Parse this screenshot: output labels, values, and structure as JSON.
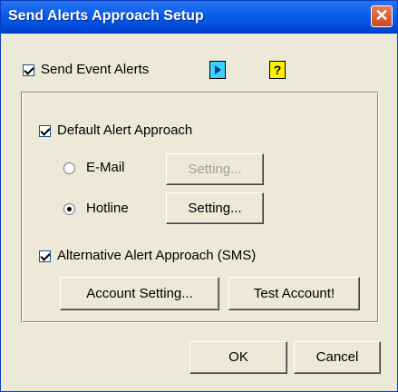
{
  "window": {
    "title": "Send Alerts Approach Setup",
    "close_symbol": "✕"
  },
  "send_event_alerts": {
    "label": "Send Event Alerts",
    "checked": true
  },
  "icons": {
    "play": "play-icon",
    "help": "help-icon",
    "help_glyph": "?"
  },
  "default_alert": {
    "label": "Default Alert Approach",
    "checked": true,
    "options": [
      {
        "label": "E-Mail",
        "selected": false,
        "setting_label": "Setting...",
        "setting_enabled": false
      },
      {
        "label": "Hotline",
        "selected": true,
        "setting_label": "Setting...",
        "setting_enabled": true
      }
    ]
  },
  "alternative_alert": {
    "label": "Alternative Alert Approach (SMS)",
    "checked": true,
    "account_setting_label": "Account Setting...",
    "test_account_label": "Test Account!"
  },
  "footer": {
    "ok_label": "OK",
    "cancel_label": "Cancel"
  },
  "colors": {
    "title_bar": "#0a5fe8",
    "dialog_bg": "#ece9d8",
    "close_button": "#d4552b"
  }
}
